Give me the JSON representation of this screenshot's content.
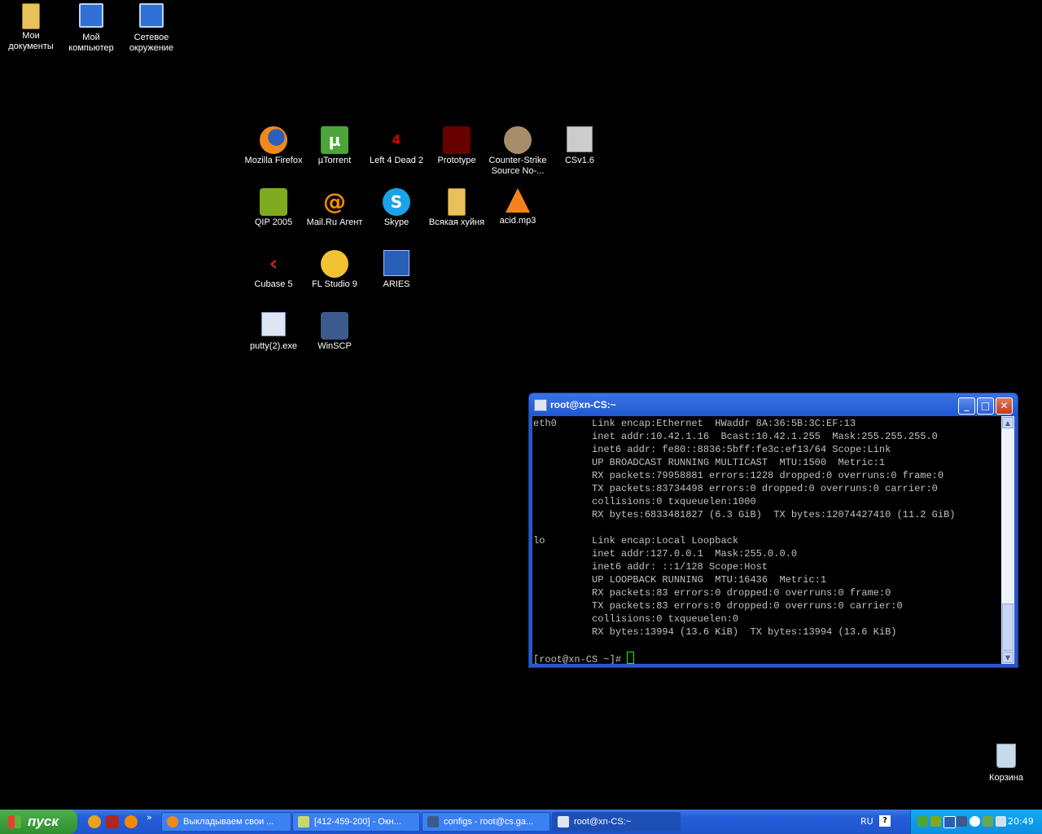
{
  "desktop": {
    "icons": [
      {
        "key": "my_documents",
        "label_line1": "Мои",
        "label_line2": "документы"
      },
      {
        "key": "my_computer",
        "label_line1": "Мой",
        "label_line2": "компьютер"
      },
      {
        "key": "network",
        "label_line1": "Сетевое",
        "label_line2": "окружение"
      },
      {
        "key": "firefox",
        "label": "Mozilla Firefox"
      },
      {
        "key": "utorrent",
        "label": "µTorrent"
      },
      {
        "key": "l4d2",
        "label": "Left 4 Dead 2"
      },
      {
        "key": "prototype",
        "label": "Prototype"
      },
      {
        "key": "css",
        "label_line1": "Counter-Strike",
        "label_line2": "Source No-..."
      },
      {
        "key": "cs16",
        "label": "CSv1.6"
      },
      {
        "key": "qip",
        "label": "QIP 2005"
      },
      {
        "key": "mailru",
        "label": "Mail.Ru Агент"
      },
      {
        "key": "skype",
        "label": "Skype"
      },
      {
        "key": "folder_misc",
        "label": "Всякая хуйня"
      },
      {
        "key": "acid",
        "label": "acid.mp3"
      },
      {
        "key": "cubase",
        "label": "Cubase 5"
      },
      {
        "key": "flstudio",
        "label": "FL Studio 9"
      },
      {
        "key": "aries",
        "label": "ARIES"
      },
      {
        "key": "putty",
        "label": "putty(2).exe"
      },
      {
        "key": "winscp",
        "label": "WinSCP"
      },
      {
        "key": "recycle",
        "label": "Корзина"
      }
    ]
  },
  "terminal": {
    "title": "root@xn-CS:~",
    "buttons": {
      "minimize": "_",
      "maximize": "□",
      "close": "✕"
    },
    "lines": [
      "eth0      Link encap:Ethernet  HWaddr 8A:36:5B:3C:EF:13",
      "          inet addr:10.42.1.16  Bcast:10.42.1.255  Mask:255.255.255.0",
      "          inet6 addr: fe80::8836:5bff:fe3c:ef13/64 Scope:Link",
      "          UP BROADCAST RUNNING MULTICAST  MTU:1500  Metric:1",
      "          RX packets:79958881 errors:1228 dropped:0 overruns:0 frame:0",
      "          TX packets:83734498 errors:0 dropped:0 overruns:0 carrier:0",
      "          collisions:0 txqueuelen:1000",
      "          RX bytes:6833481827 (6.3 GiB)  TX bytes:12074427410 (11.2 GiB)",
      "",
      "lo        Link encap:Local Loopback",
      "          inet addr:127.0.0.1  Mask:255.0.0.0",
      "          inet6 addr: ::1/128 Scope:Host",
      "          UP LOOPBACK RUNNING  MTU:16436  Metric:1",
      "          RX packets:83 errors:0 dropped:0 overruns:0 frame:0",
      "          TX packets:83 errors:0 dropped:0 overruns:0 carrier:0",
      "          collisions:0 txqueuelen:0",
      "          RX bytes:13994 (13.6 KiB)  TX bytes:13994 (13.6 KiB)",
      ""
    ],
    "prompt": "[root@xn-CS ~]# "
  },
  "taskbar": {
    "start_label": "пуск",
    "quick_launch_more": "»",
    "tasks": [
      {
        "label": "Выкладываем свои ..."
      },
      {
        "label": "[412-459-200] - Окн..."
      },
      {
        "label": "configs - root@cs.ga..."
      },
      {
        "label": "root@xn-CS:~"
      }
    ],
    "language": "RU",
    "help": "?",
    "clock": "20:49"
  }
}
